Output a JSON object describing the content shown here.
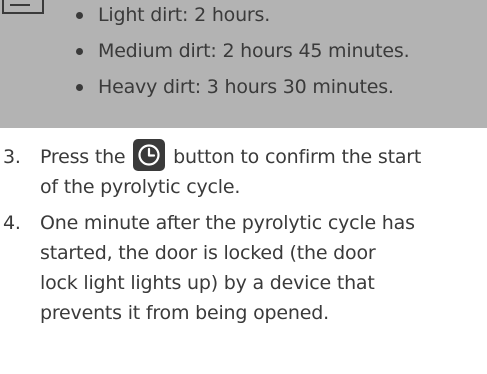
{
  "note": {
    "bullets": [
      "Light dirt: 2 hours.",
      "Medium dirt: 2 hours 45 minutes.",
      "Heavy dirt: 3 hours 30 minutes."
    ]
  },
  "steps": [
    {
      "number": "3.",
      "text_before": "Press the",
      "icon": "clock-icon",
      "text_after_line1": "button to confirm the start",
      "text_after_line2": "of the pyrolytic cycle."
    },
    {
      "number": "4.",
      "lines": [
        "One minute after the pyrolytic cycle has",
        "started, the door is locked (the door",
        "lock light lights up) by a device that",
        "prevents it from being opened."
      ]
    }
  ]
}
